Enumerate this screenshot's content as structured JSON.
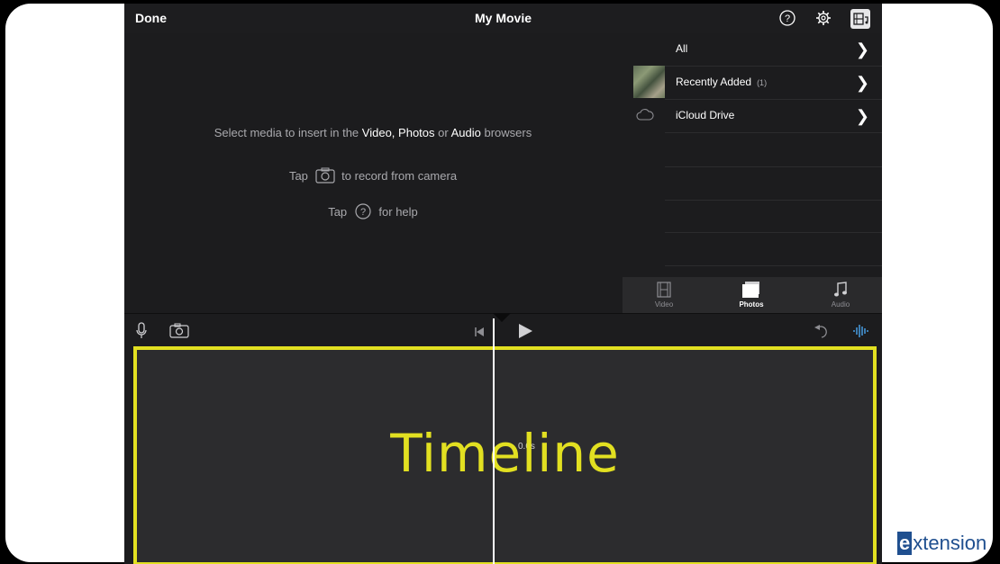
{
  "topbar": {
    "done_label": "Done",
    "title": "My Movie",
    "icons": [
      "help-icon",
      "settings-icon",
      "media-browser-icon"
    ]
  },
  "viewer": {
    "line1_prefix": "Select media to insert in the",
    "line1_video": "Video",
    "line1_comma": ",",
    "line1_photos": "Photos",
    "line1_or": "or",
    "line1_audio": "Audio",
    "line1_suffix": "browsers",
    "line2_tap": "Tap",
    "line2_text": "to record from camera",
    "line3_tap": "Tap",
    "line3_text": "for help"
  },
  "browser": {
    "rows": [
      {
        "label": "All",
        "count": ""
      },
      {
        "label": "Recently Added",
        "count": "(1)"
      },
      {
        "label": "iCloud Drive",
        "count": ""
      }
    ],
    "tabs": [
      {
        "label": "Video",
        "active": false
      },
      {
        "label": "Photos",
        "active": true
      },
      {
        "label": "Audio",
        "active": false
      }
    ]
  },
  "timeline": {
    "overlay_label": "Timeline",
    "playhead_time": "0.0s",
    "highlight_color": "#e2e021"
  },
  "watermark": {
    "logo_letter": "e",
    "logo_rest": "xtension"
  },
  "colors": {
    "background": "#1c1c1e",
    "accent_blue": "#4aa6f0"
  }
}
